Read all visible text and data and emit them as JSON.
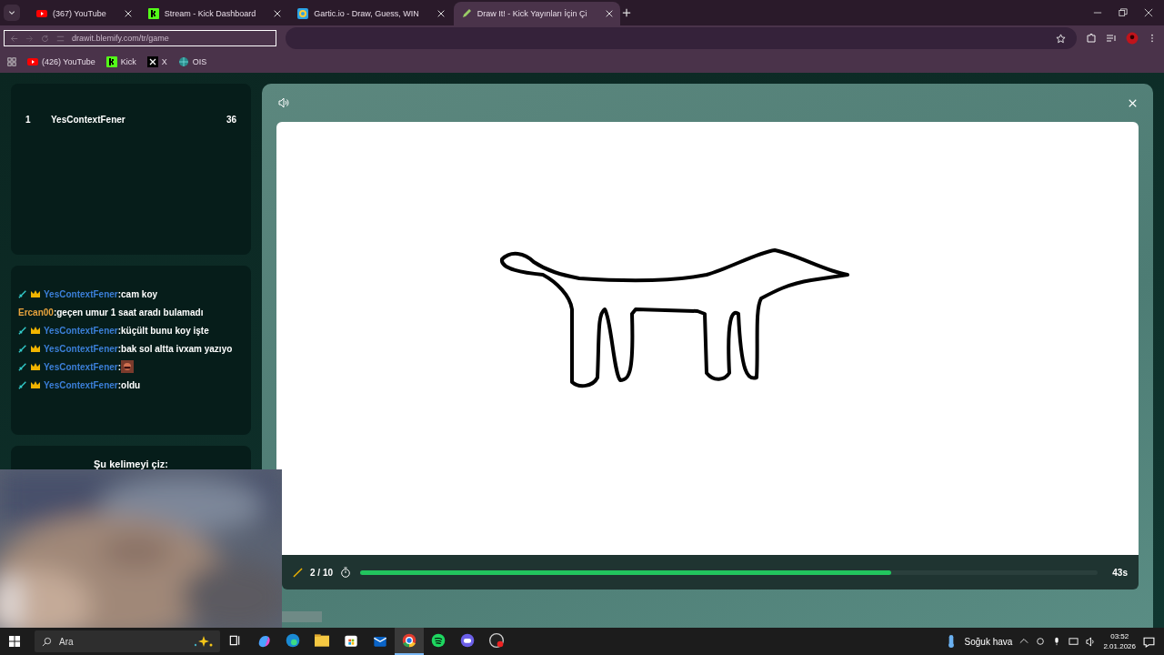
{
  "browser": {
    "tabs": [
      {
        "title": "(367) YouTube",
        "kind": "youtube",
        "selected": false
      },
      {
        "title": "Stream - Kick Dashboard",
        "kind": "kick",
        "selected": false
      },
      {
        "title": "Gartic.io - Draw, Guess, WIN",
        "kind": "gartic",
        "selected": false
      },
      {
        "title": "Draw It! - Kick Yayınları İçin Çi",
        "kind": "pencil",
        "selected": true
      }
    ],
    "address": "drawit.blemify.com/tr/game",
    "bookmarks": [
      {
        "label": "(426) YouTube",
        "kind": "youtube"
      },
      {
        "label": "Kick",
        "kind": "kick"
      },
      {
        "label": "X",
        "kind": "x"
      },
      {
        "label": "OIS",
        "kind": "globe"
      }
    ]
  },
  "leaderboard": [
    {
      "rank": "1",
      "name": "YesContextFener",
      "score": "36"
    }
  ],
  "chat": [
    {
      "kind": "text",
      "user": "YesContextFener",
      "moderator": true,
      "color": "#3b7fd8",
      "text": ":cam koy"
    },
    {
      "kind": "text",
      "user": "Ercan00",
      "moderator": false,
      "color": "#e8a33d",
      "text": ":geçen umur 1 saat aradı bulamadı"
    },
    {
      "kind": "text",
      "user": "YesContextFener",
      "moderator": true,
      "color": "#3b7fd8",
      "text": ":küçült bunu koy işte"
    },
    {
      "kind": "text",
      "user": "YesContextFener",
      "moderator": true,
      "color": "#3b7fd8",
      "text": ":bak sol altta ivxam yazıyo"
    },
    {
      "kind": "emote",
      "user": "YesContextFener",
      "moderator": true,
      "color": "#3b7fd8",
      "text": ":"
    },
    {
      "kind": "text",
      "user": "YesContextFener",
      "moderator": true,
      "color": "#3b7fd8",
      "text": ":oldu"
    }
  ],
  "word_prompt": "Şu kelimeyi çiz:",
  "round": "2 / 10",
  "timer": {
    "level": 0.72,
    "reading": "43s"
  },
  "taskbar": {
    "search_placeholder": "Ara",
    "apps": [
      {
        "kind": "taskview",
        "selected": false
      },
      {
        "kind": "copilot",
        "selected": false
      },
      {
        "kind": "edge",
        "selected": false
      },
      {
        "kind": "files",
        "selected": false
      },
      {
        "kind": "store",
        "selected": false
      },
      {
        "kind": "mail",
        "selected": false
      },
      {
        "kind": "chrome",
        "selected": true
      },
      {
        "kind": "spotify",
        "selected": false
      },
      {
        "kind": "discord",
        "selected": false
      },
      {
        "kind": "obs",
        "selected": false
      }
    ],
    "weather": "Soğuk hava",
    "time": "03:52",
    "date": "2.01.2026"
  }
}
